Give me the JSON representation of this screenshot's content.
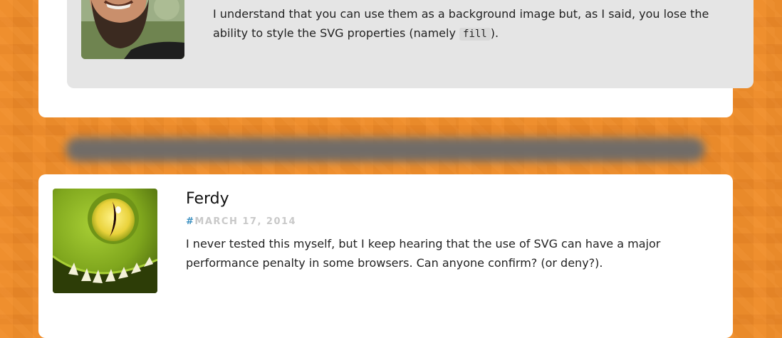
{
  "reply_comment": {
    "text_before": "I understand that you can use them as a background image but, as I said, you lose the ability to style the SVG properties (namely ",
    "code": "fill",
    "text_after": ")."
  },
  "comment": {
    "author": "Ferdy",
    "permalink_symbol": "#",
    "date": "MARCH 17, 2014",
    "text": "I never tested this myself, but I keep hearing that the use of SVG can have a major performance penalty in some browsers. Can anyone confirm? (or deny?)."
  },
  "colors": {
    "background": "#e98a2a",
    "card": "#ffffff",
    "reply_box": "#e5e5e5",
    "permalink": "#3a8fc0",
    "date": "#c9c9c9"
  },
  "icons": [
    "user-avatar-photo",
    "dragon-avatar"
  ]
}
